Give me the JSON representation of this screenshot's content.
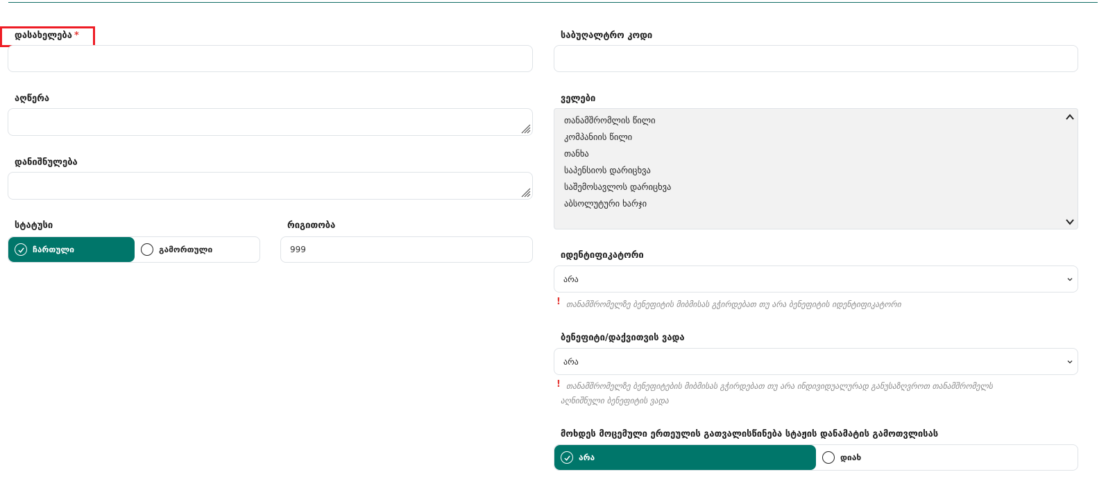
{
  "form": {
    "name_label": "დასახელება",
    "required_mark": "*",
    "description_label": "აღწერა",
    "purpose_label": "დანიშნულება",
    "status_label": "სტატუსი",
    "status_options": [
      "ჩართული",
      "გამორთული"
    ],
    "status_selected": "ჩართული",
    "order_label": "რიგითობა",
    "order_value": "999",
    "accounting_code_label": "საბუღალტრო კოდი",
    "fields_label": "ველები",
    "fields_items": [
      "თანამშრომლის წილი",
      "კომპანიის წილი",
      "თანხა",
      "საპენსიოს დარიცხვა",
      "საშემოსავლოს დარიცხვა",
      "აბსოლუტური ხარჯი"
    ],
    "identifier_label": "იდენტიფიკატორი",
    "identifier_value": "არა",
    "identifier_hint": "თანამშრომელზე ბენეფიტის მიბმისას გჭირდებათ თუ არა ბენეფიტის იდენტიფიკატორი",
    "benefit_term_label": "ბენეფიტი/დაქვითვის ვადა",
    "benefit_term_value": "არა",
    "benefit_term_hint_line1": "თანამშრომელზე ბენეფიტების მიბმისას გჭირდებათ თუ არა ინდივიდუალურად განუსაზღვროთ თანამშრომელს",
    "benefit_term_hint_line2": "აღნიშნული ბენეფიტის ვადა",
    "hint_mark": "!",
    "consider_label": "მოხდეს მოცემული ერთეულის გათვალისწინება სტაჟის დანამატის გამოთვლისას",
    "consider_options": [
      "არა",
      "დიახ"
    ],
    "consider_selected": "არა"
  },
  "colors": {
    "accent": "#00766a",
    "required": "#e53935",
    "highlight_box": "#ee1c24"
  }
}
